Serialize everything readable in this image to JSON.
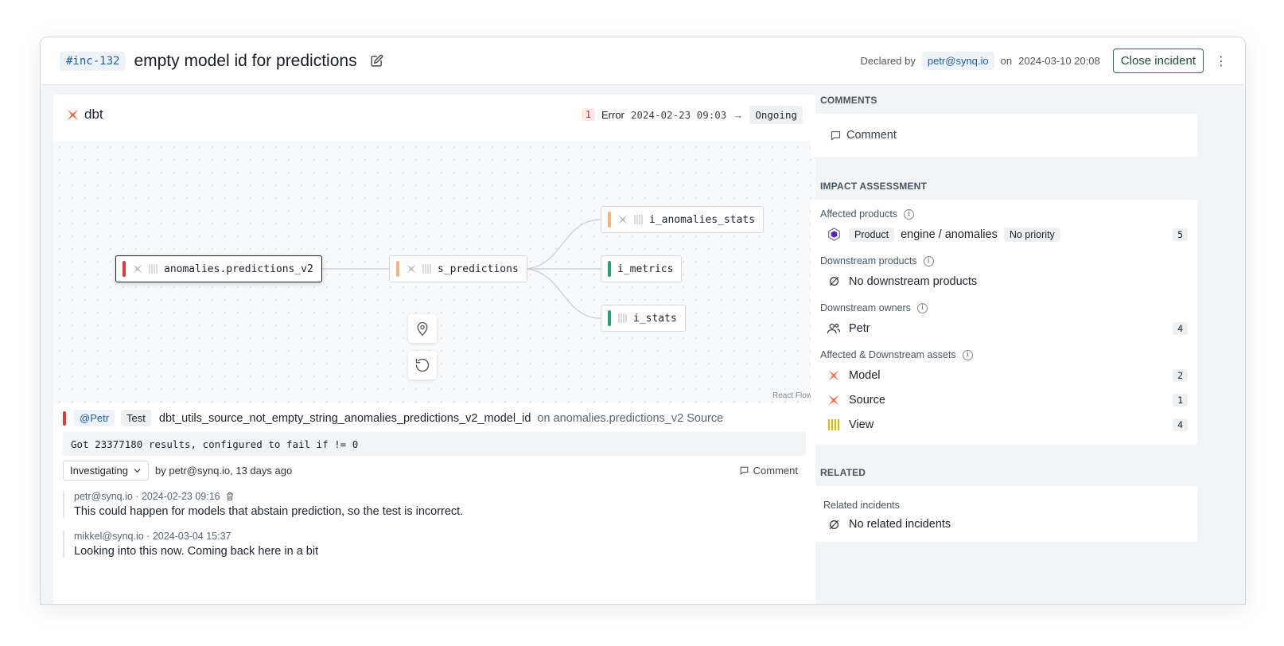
{
  "incident": {
    "id": "#inc-132",
    "title": "empty model id for predictions",
    "declared_by_label": "Declared by",
    "declared_by": "petr@synq.io",
    "on_label": "on",
    "declared_at": "2024-03-10 20:08",
    "close_label": "Close incident"
  },
  "source_card": {
    "title": "dbt",
    "error_count": "1",
    "error_label": "Error",
    "error_time": "2024-02-23 09:03",
    "arrow": "→",
    "status": "Ongoing"
  },
  "graph": {
    "nodes": [
      {
        "label": "anomalies.predictions_v2",
        "color": "#e53935"
      },
      {
        "label": "s_predictions",
        "color": "#f5b27a"
      },
      {
        "label": "i_anomalies_stats",
        "color": "#f5b27a"
      },
      {
        "label": "i_metrics",
        "color": "#26a37a"
      },
      {
        "label": "i_stats",
        "color": "#26a37a"
      }
    ],
    "attribution": "React Flow"
  },
  "test": {
    "owner": "@Petr",
    "kind": "Test",
    "name": "dbt_utils_source_not_empty_string_anomalies_predictions_v2_model_id",
    "on_text": "on anomalies.predictions_v2 Source",
    "result": "Got 23377180 results, configured to fail if != 0",
    "status": "Investigating",
    "by_text": "by petr@synq.io, 13 days ago",
    "comment_label": "Comment"
  },
  "comments": [
    {
      "meta": "petr@synq.io · 2024-02-23 09:16",
      "text": "This could happen for models that abstain prediction, so the test is incorrect."
    },
    {
      "meta": "mikkel@synq.io · 2024-03-04 15:37",
      "text": "Looking into this now. Coming back here in a bit"
    }
  ],
  "sidebar": {
    "comments_title": "COMMENTS",
    "comment_placeholder": "Comment",
    "impact_title": "IMPACT ASSESSMENT",
    "affected_products_label": "Affected products",
    "product_chip": "Product",
    "product_name": "engine / anomalies",
    "priority": "No priority",
    "product_count": "5",
    "downstream_products_label": "Downstream products",
    "no_downstream_products": "No downstream products",
    "downstream_owners_label": "Downstream owners",
    "owner_name": "Petr",
    "owner_count": "4",
    "assets_label": "Affected & Downstream assets",
    "assets": [
      {
        "name": "Model",
        "count": "2"
      },
      {
        "name": "Source",
        "count": "1"
      },
      {
        "name": "View",
        "count": "4"
      }
    ],
    "related_title": "RELATED",
    "related_incidents_label": "Related incidents",
    "no_related": "No related incidents"
  }
}
